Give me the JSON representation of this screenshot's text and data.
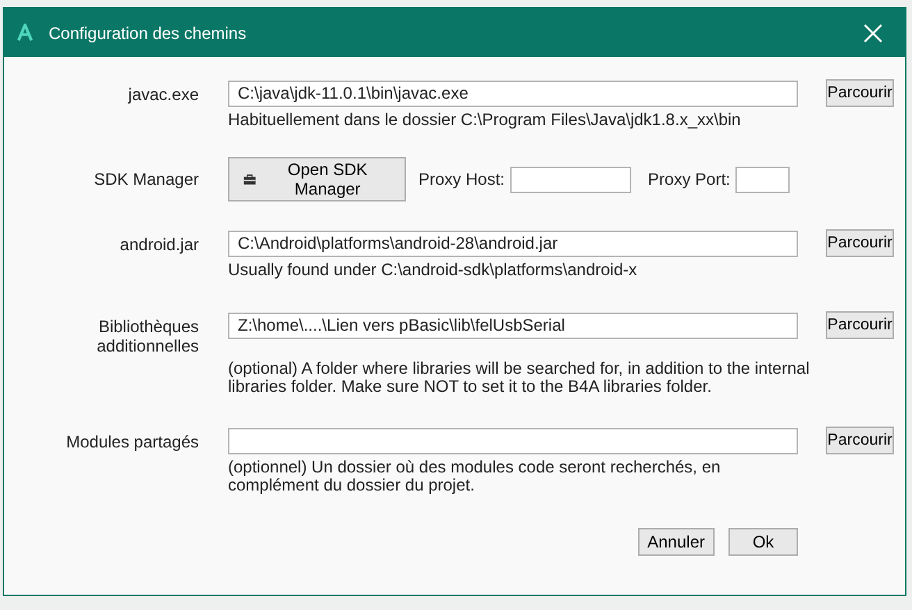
{
  "window": {
    "title": "Configuration des chemins"
  },
  "rows": [
    {
      "kind": "path",
      "label": "javac.exe",
      "value": "C:\\java\\jdk-11.0.1\\bin\\javac.exe",
      "hint": "Habituellement dans le dossier C:\\Program Files\\Java\\jdk1.8.x_xx\\bin",
      "button": "Parcourir"
    },
    {
      "kind": "sdk",
      "label": "SDK Manager",
      "button": "Open SDK Manager",
      "proxy_host_label": "Proxy Host:",
      "proxy_port_label": "Proxy Port:"
    },
    {
      "kind": "path",
      "label": "android.jar",
      "value": "C:\\Android\\platforms\\android-28\\android.jar",
      "hint": "Usually found under C:\\android-sdk\\platforms\\android-x",
      "button": "Parcourir"
    },
    {
      "kind": "path",
      "label": "Bibliothèques additionnelles",
      "value": "Z:\\home\\....\\Lien vers pBasic\\lib\\felUsbSerial",
      "hint": "(optional) A folder where libraries will be searched for, in addition to the internal libraries folder. Make sure NOT to set it to the B4A libraries folder.",
      "button": "Parcourir"
    },
    {
      "kind": "path",
      "label": "Modules partagés",
      "value": "",
      "hint": "(optionnel) Un dossier où des modules code seront recherchés, en complément du dossier du projet.",
      "button": "Parcourir"
    }
  ],
  "buttons": [
    "Annuler",
    "Ok"
  ]
}
